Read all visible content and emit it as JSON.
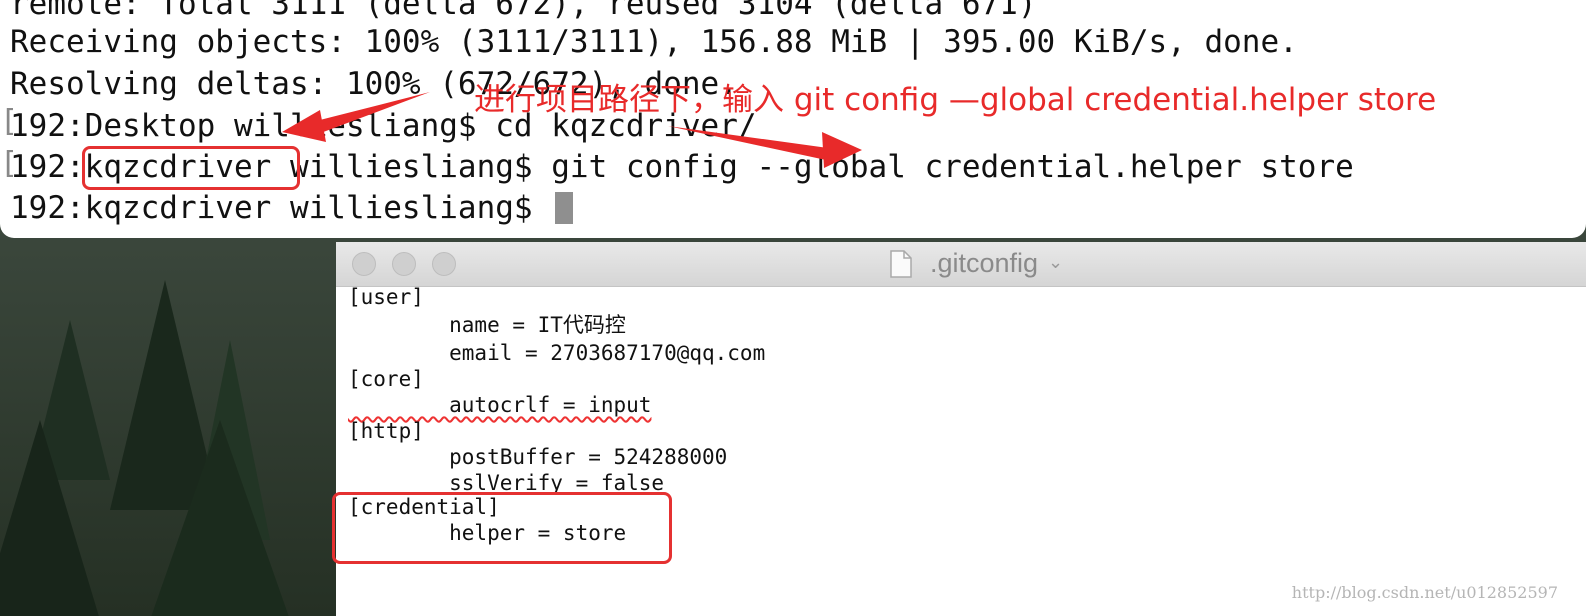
{
  "terminal": {
    "lines": [
      "remote: Total 3111 (delta 672), reused 3104 (delta 671)",
      "Receiving objects: 100% (3111/3111), 156.88 MiB | 395.00 KiB/s, done.",
      "Resolving deltas: 100% (672/672), done.",
      "192:Desktop williesliang$ cd kqzcdriver/",
      "192:kqzcdriver williesliang$ git config --global credential.helper store",
      "192:kqzcdriver williesliang$ "
    ],
    "annotation": "进行项目路径下，输入 git config —global credential.helper store",
    "annotation_color": "#e82a2a"
  },
  "editor": {
    "title": ".gitconfig",
    "lines": [
      "[user]",
      "        name = IT代码控",
      "        email = 2703687170@qq.com",
      "[core]",
      "        autocrlf = input",
      "[http]",
      "        postBuffer = 524288000",
      "        sslVerify = false",
      "[credential]",
      "        helper = store"
    ]
  },
  "watermark": "http://blog.csdn.net/u012852597"
}
